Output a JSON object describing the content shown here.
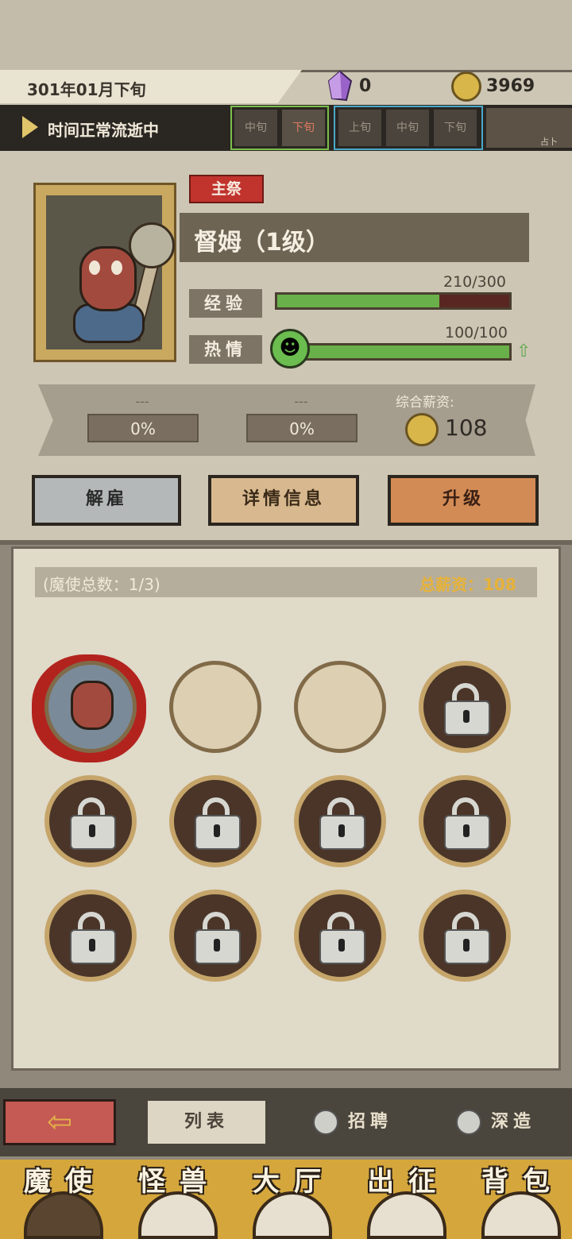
{
  "header": {
    "date": "301年01月下旬",
    "crystals": "0",
    "gold": "3969"
  },
  "timebar": {
    "status": "时间正常流逝中",
    "cells": [
      "中旬",
      "下旬",
      "上旬",
      "中旬",
      "下旬"
    ],
    "divination_label": "占卜"
  },
  "character": {
    "role": "主祭",
    "name": "督姆（1级）",
    "exp_label": "经验",
    "exp_value": "210/300",
    "exp_fraction": 0.7,
    "passion_label": "热情",
    "passion_value": "100/100",
    "passion_fraction": 1.0
  },
  "salary": {
    "slot1_name": "---",
    "slot1_pct": "0%",
    "slot2_name": "---",
    "slot2_pct": "0%",
    "label": "综合薪资:",
    "value": "108"
  },
  "buttons": {
    "fire": "解雇",
    "detail": "详情信息",
    "upgrade": "升级"
  },
  "list": {
    "count": "(魔使总数：1/3)",
    "total_salary": "总薪资：108",
    "slots": [
      "filled",
      "empty",
      "empty",
      "lock",
      "lock",
      "lock",
      "lock",
      "lock",
      "lock",
      "lock",
      "lock",
      "lock"
    ]
  },
  "subtabs": {
    "list": "列表",
    "recruit": "招聘",
    "deep": "深造"
  },
  "nav": {
    "items": [
      "魔使",
      "怪兽",
      "大厅",
      "出征",
      "背包"
    ]
  }
}
